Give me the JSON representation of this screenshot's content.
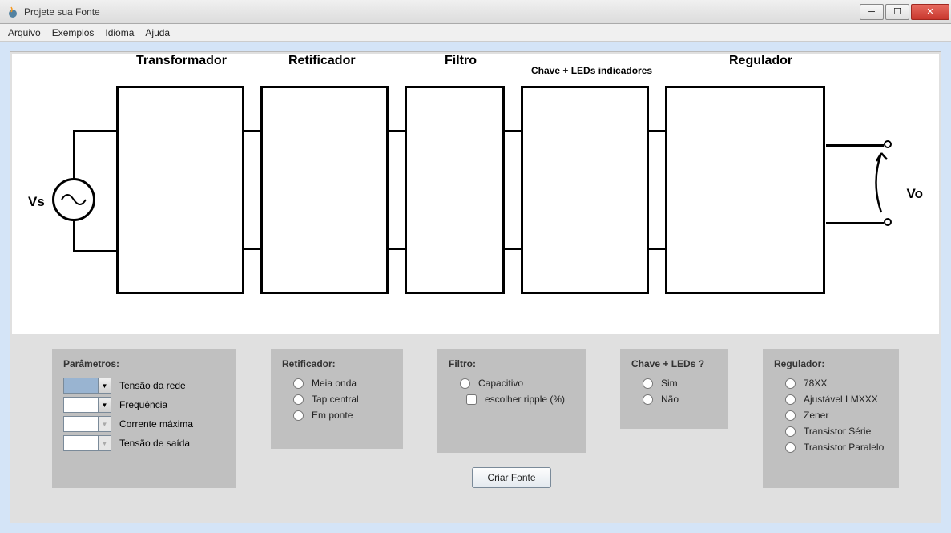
{
  "window": {
    "title": "Projete sua Fonte"
  },
  "menu": {
    "arquivo": "Arquivo",
    "exemplos": "Exemplos",
    "idioma": "Idioma",
    "ajuda": "Ajuda"
  },
  "diagram": {
    "vs": "Vs",
    "vo": "Vo",
    "transformador": "Transformador",
    "retificador": "Retificador",
    "filtro": "Filtro",
    "chave_leds": "Chave + LEDs indicadores",
    "regulador": "Regulador"
  },
  "panels": {
    "parametros": {
      "title": "Parâmetros:",
      "tensao_rede": "Tensão da rede",
      "frequencia": "Frequência",
      "corrente_max": "Corrente máxima",
      "tensao_saida": "Tensão de saída"
    },
    "retificador": {
      "title": "Retificador:",
      "meia_onda": "Meia onda",
      "tap_central": "Tap central",
      "em_ponte": "Em ponte"
    },
    "filtro": {
      "title": "Filtro:",
      "capacitivo": "Capacitivo",
      "escolher_ripple": "escolher ripple (%)"
    },
    "chave": {
      "title": "Chave + LEDs ?",
      "sim": "Sim",
      "nao": "Não"
    },
    "regulador": {
      "title": "Regulador:",
      "r78xx": "78XX",
      "ajustavel": "Ajustável LMXXX",
      "zener": "Zener",
      "transistor_serie": "Transistor Série",
      "transistor_paralelo": "Transistor Paralelo"
    }
  },
  "buttons": {
    "criar_fonte": "Criar Fonte"
  }
}
